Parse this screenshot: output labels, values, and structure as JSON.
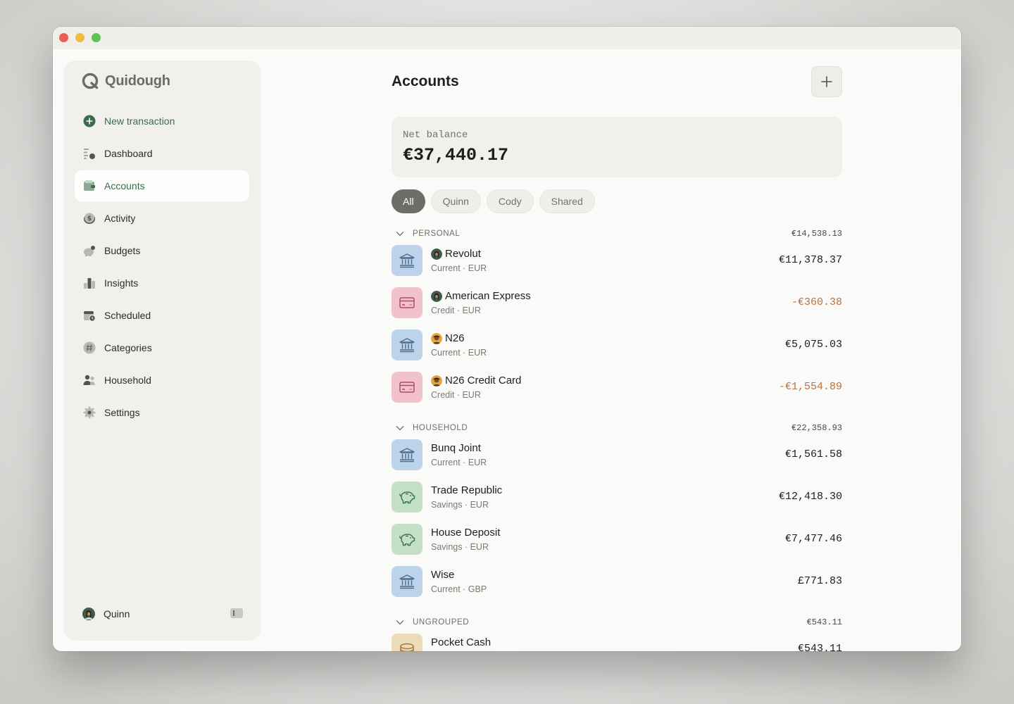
{
  "app": {
    "name": "Quidough"
  },
  "sidebar": {
    "new_transaction": "New transaction",
    "items": [
      {
        "label": "Dashboard",
        "icon": "dashboard-icon"
      },
      {
        "label": "Accounts",
        "icon": "wallet-icon",
        "active": true
      },
      {
        "label": "Activity",
        "icon": "dollar-coin-icon"
      },
      {
        "label": "Budgets",
        "icon": "piggy-bank-icon"
      },
      {
        "label": "Insights",
        "icon": "bar-chart-icon"
      },
      {
        "label": "Scheduled",
        "icon": "calendar-clock-icon"
      },
      {
        "label": "Categories",
        "icon": "hashtag-icon"
      },
      {
        "label": "Household",
        "icon": "people-icon"
      },
      {
        "label": "Settings",
        "icon": "gear-icon"
      }
    ],
    "user": {
      "name": "Quinn"
    }
  },
  "main": {
    "title": "Accounts",
    "net_balance_label": "Net balance",
    "net_balance_value": "€37,440.17",
    "filters": [
      "All",
      "Quinn",
      "Cody",
      "Shared"
    ],
    "active_filter": "All",
    "groups": [
      {
        "name": "PERSONAL",
        "total": "€14,538.13",
        "accounts": [
          {
            "name": "Revolut",
            "type": "Current · EUR",
            "amount": "€11,378.37",
            "kind": "bank",
            "owner": "quinn"
          },
          {
            "name": "American Express",
            "type": "Credit · EUR",
            "amount": "-€360.38",
            "kind": "credit",
            "owner": "quinn"
          },
          {
            "name": "N26",
            "type": "Current · EUR",
            "amount": "€5,075.03",
            "kind": "bank",
            "owner": "cody"
          },
          {
            "name": "N26 Credit Card",
            "type": "Credit · EUR",
            "amount": "-€1,554.89",
            "kind": "credit",
            "owner": "cody"
          }
        ]
      },
      {
        "name": "HOUSEHOLD",
        "total": "€22,358.93",
        "accounts": [
          {
            "name": "Bunq Joint",
            "type": "Current · EUR",
            "amount": "€1,561.58",
            "kind": "bank"
          },
          {
            "name": "Trade Republic",
            "type": "Savings · EUR",
            "amount": "€12,418.30",
            "kind": "savings"
          },
          {
            "name": "House Deposit",
            "type": "Savings · EUR",
            "amount": "€7,477.46",
            "kind": "savings"
          },
          {
            "name": "Wise",
            "type": "Current · GBP",
            "amount": "£771.83",
            "kind": "bank"
          }
        ]
      },
      {
        "name": "UNGROUPED",
        "total": "€543.11",
        "accounts": [
          {
            "name": "Pocket Cash",
            "type": "",
            "amount": "€543.11",
            "kind": "cash"
          }
        ]
      }
    ]
  },
  "colors": {
    "accent_green": "#3c6b4b",
    "negative_amount": "#b7743f",
    "bank_tile": "#bcd3ea",
    "credit_tile": "#f2c2cc",
    "savings_tile": "#c4e0c7",
    "cash_tile": "#eddcba"
  }
}
